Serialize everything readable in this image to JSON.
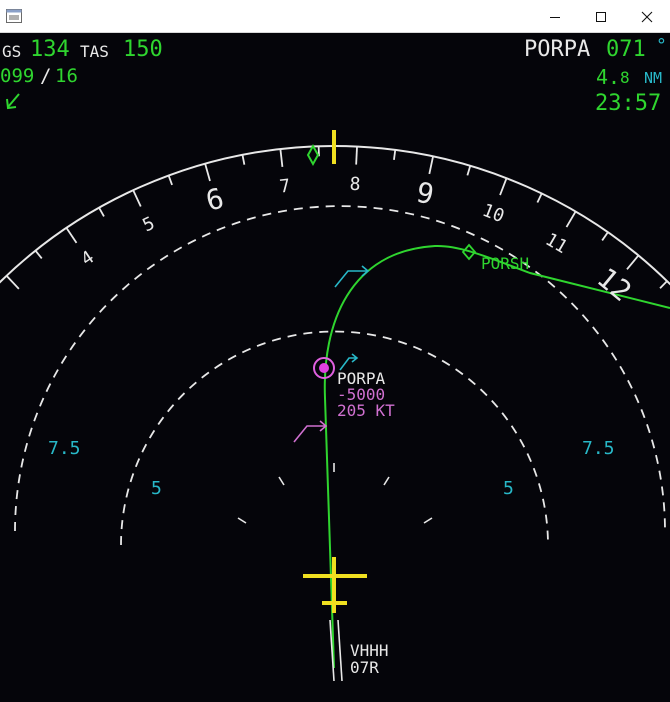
{
  "window": {
    "minimize_glyph": "—",
    "maximize_glyph": "☐",
    "close_glyph": "✕"
  },
  "header_left": {
    "gs_label": "GS",
    "gs_value": "134",
    "tas_label": "TAS",
    "tas_value": "150",
    "wind_dir": "099",
    "wind_sep": "/",
    "wind_speed": "16"
  },
  "header_right": {
    "waypoint": "PORPA",
    "bearing": "071",
    "bearing_unit": "°",
    "distance_int": "4.",
    "distance_dec": "8",
    "distance_unit": "NM",
    "eta": "23:57"
  },
  "compass_labels": [
    "4",
    "5",
    "6",
    "7",
    "8",
    "9",
    "10",
    "11",
    "12"
  ],
  "range_labels": {
    "outer_left": "7.5",
    "outer_right": "7.5",
    "inner_left": "5",
    "inner_right": "5"
  },
  "waypoints": {
    "porsh": "PORSH",
    "porpa": "PORPA",
    "porpa_alt": "-5000",
    "porpa_speed": "205 KT"
  },
  "runway": {
    "airport": "VHHH",
    "designator": "07R"
  },
  "colors": {
    "green": "#2fd52f",
    "cyan": "#28b8c8",
    "magenta": "#d070d0",
    "yellow": "#f0e020",
    "white": "#e8e8e8"
  }
}
